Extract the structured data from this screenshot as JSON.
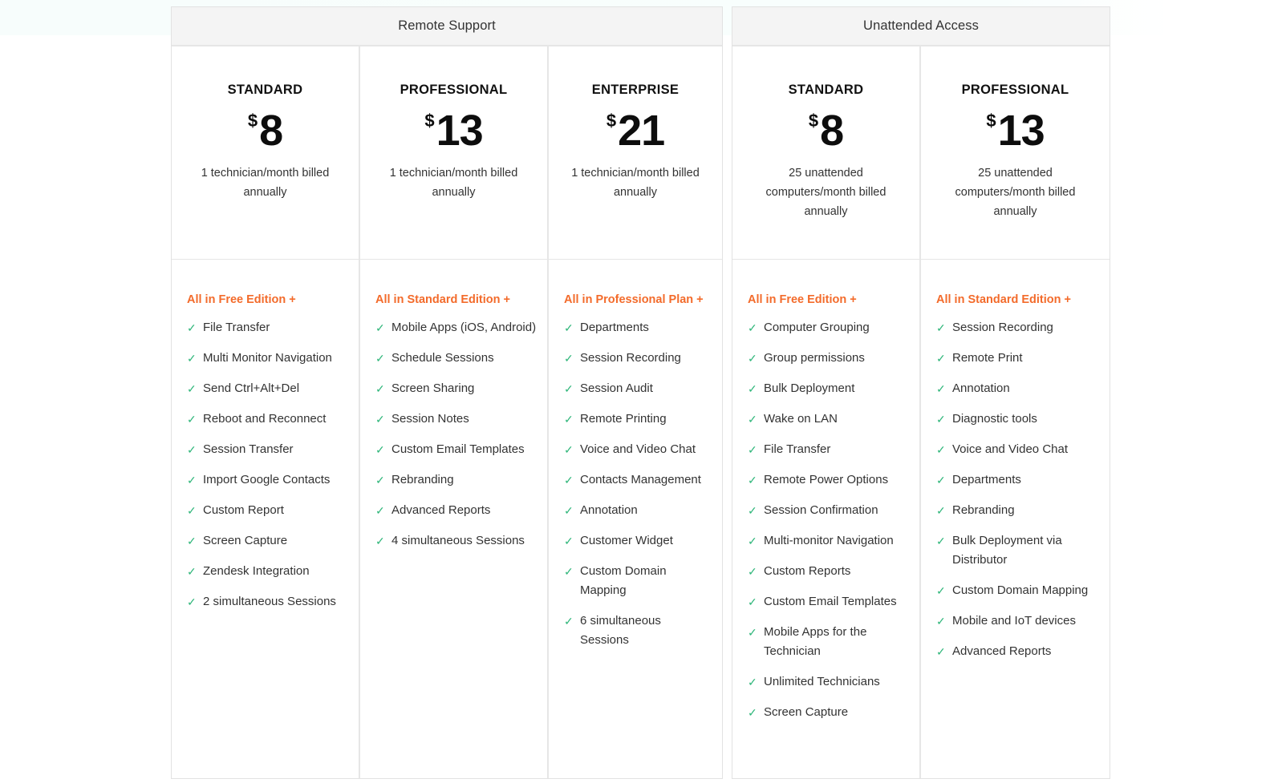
{
  "groups": [
    {
      "title": "Remote Support",
      "plans": [
        {
          "name": "STANDARD",
          "currency": "$",
          "price": "8",
          "note": "1 technician/month billed annually",
          "heading": "All in Free Edition +",
          "features": [
            "File Transfer",
            "Multi Monitor Navigation",
            "Send Ctrl+Alt+Del",
            "Reboot and Reconnect",
            "Session Transfer",
            "Import Google Contacts",
            "Custom Report",
            "Screen Capture",
            "Zendesk Integration",
            "2 simultaneous Sessions"
          ]
        },
        {
          "name": "PROFESSIONAL",
          "currency": "$",
          "price": "13",
          "note": "1 technician/month billed annually",
          "heading": "All in Standard Edition +",
          "features": [
            "Mobile Apps (iOS, Android)",
            "Schedule Sessions",
            "Screen Sharing",
            "Session Notes",
            "Custom Email Templates",
            "Rebranding",
            "Advanced Reports",
            "4 simultaneous Sessions"
          ]
        },
        {
          "name": "ENTERPRISE",
          "currency": "$",
          "price": "21",
          "note": "1 technician/month billed annually",
          "heading": "All in Professional Plan +",
          "features": [
            "Departments",
            "Session Recording",
            "Session Audit",
            "Remote Printing",
            "Voice and Video Chat",
            "Contacts Management",
            "Annotation",
            "Customer Widget",
            "Custom Domain Mapping",
            "6 simultaneous Sessions"
          ]
        }
      ]
    },
    {
      "title": "Unattended Access",
      "plans": [
        {
          "name": "STANDARD",
          "currency": "$",
          "price": "8",
          "note": "25 unattended computers/month billed annually",
          "heading": "All in Free Edition +",
          "features": [
            "Computer Grouping",
            "Group permissions",
            "Bulk Deployment",
            "Wake on LAN",
            "File Transfer",
            "Remote Power Options",
            "Session Confirmation",
            "Multi-monitor Navigation",
            "Custom Reports",
            "Custom Email Templates",
            "Mobile Apps for the Technician",
            "Unlimited Technicians",
            "Screen Capture"
          ]
        },
        {
          "name": "PROFESSIONAL",
          "currency": "$",
          "price": "13",
          "note": "25 unattended computers/month billed annually",
          "heading": "All in Standard Edition +",
          "features": [
            "Session Recording",
            "Remote Print",
            "Annotation",
            "Diagnostic tools",
            "Voice and Video Chat",
            "Departments",
            "Rebranding",
            "Bulk Deployment via Distributor",
            "Custom Domain Mapping",
            "Mobile and IoT devices",
            "Advanced Reports"
          ]
        }
      ]
    }
  ],
  "icons": {
    "feature_check": "check-icon"
  },
  "colors": {
    "accent_orange": "#f36b2b",
    "check_green": "#2fb67a",
    "header_bg": "#f4f4f4",
    "border": "#e6e6e6"
  }
}
